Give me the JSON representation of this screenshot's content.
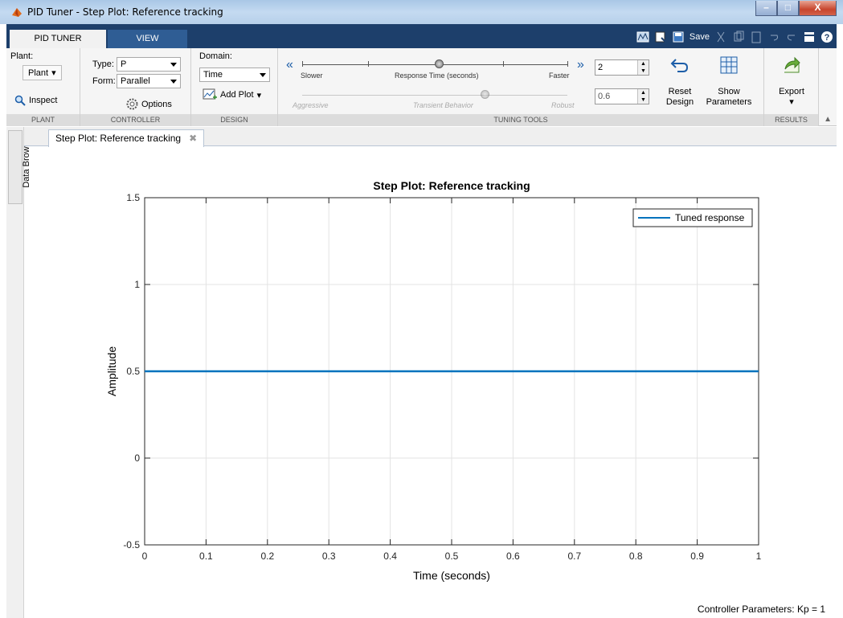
{
  "window": {
    "title": "PID Tuner - Step Plot: Reference tracking",
    "buttons": [
      "–",
      "□",
      "X"
    ]
  },
  "tabs": [
    {
      "label": "PID TUNER"
    },
    {
      "label": "VIEW"
    }
  ],
  "quick_access": {
    "save_label": "Save"
  },
  "ribbon": {
    "plant": {
      "label": "Plant:",
      "dropdown": "Plant",
      "inspect": "Inspect",
      "section": "PLANT"
    },
    "controller": {
      "type_label": "Type:",
      "type_value": "P",
      "form_label": "Form:",
      "form_value": "Parallel",
      "options": "Options",
      "section": "CONTROLLER"
    },
    "design": {
      "domain_label": "Domain:",
      "domain_value": "Time",
      "add_plot": "Add Plot",
      "section": "DESIGN"
    },
    "tuning": {
      "slower": "Slower",
      "response_time": "Response Time (seconds)",
      "faster": "Faster",
      "aggressive": "Aggressive",
      "transient": "Transient Behavior",
      "robust": "Robust",
      "response_value": "2",
      "transient_value": "0.6",
      "reset": [
        "Reset",
        "Design"
      ],
      "show": [
        "Show",
        "Parameters"
      ],
      "section": "TUNING TOOLS"
    },
    "results": {
      "export": "Export",
      "section": "RESULTS"
    }
  },
  "side": {
    "data_browser": "Data Browser"
  },
  "doc_tab": {
    "label": "Step Plot: Reference tracking"
  },
  "status": "Controller Parameters: Kp = 1",
  "chart_data": {
    "type": "line",
    "title": "Step Plot: Reference tracking",
    "xlabel": "Time (seconds)",
    "ylabel": "Amplitude",
    "xlim": [
      0,
      1
    ],
    "ylim": [
      -0.5,
      1.5
    ],
    "xticks": [
      0,
      0.1,
      0.2,
      0.3,
      0.4,
      0.5,
      0.6,
      0.7,
      0.8,
      0.9,
      1
    ],
    "yticks": [
      -0.5,
      0,
      0.5,
      1,
      1.5
    ],
    "grid": true,
    "legend": "top-right",
    "series": [
      {
        "name": "Tuned response",
        "color": "#0072bd",
        "x": [
          0,
          1
        ],
        "y": [
          0.5,
          0.5
        ]
      }
    ]
  }
}
